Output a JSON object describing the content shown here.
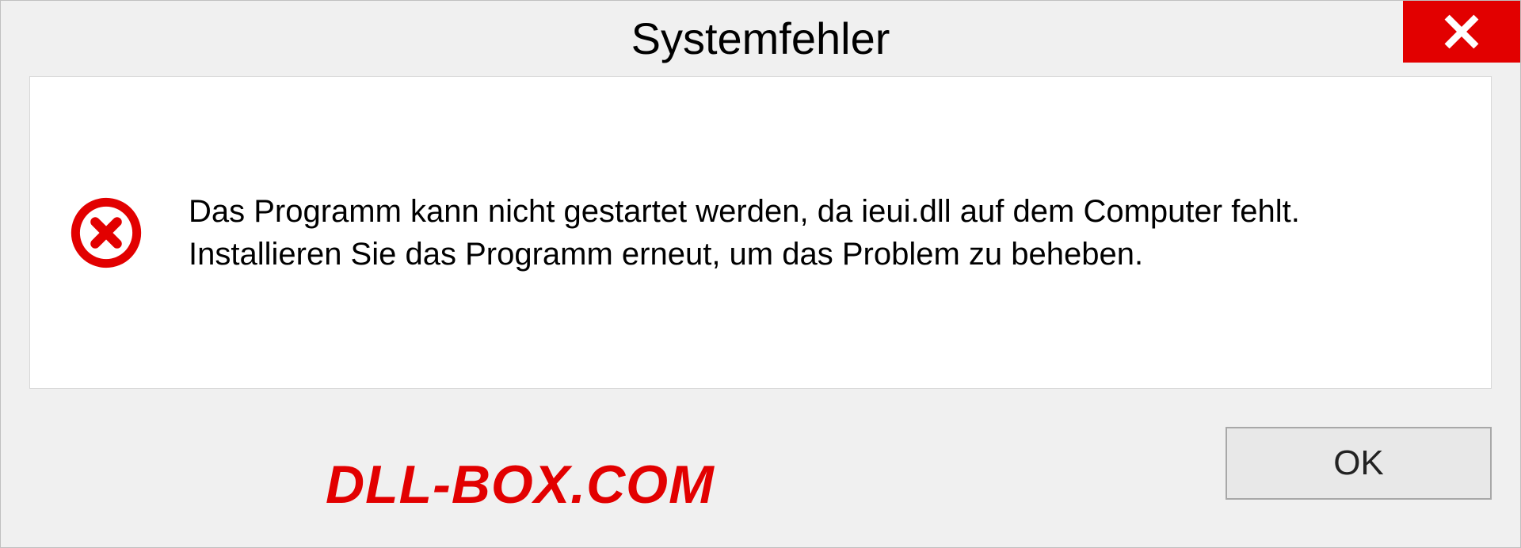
{
  "dialog": {
    "title": "Systemfehler",
    "message": "Das Programm kann nicht gestartet werden, da ieui.dll auf dem Computer fehlt. Installieren Sie das Programm erneut, um das Problem zu beheben.",
    "ok_label": "OK"
  },
  "watermark": "DLL-BOX.COM"
}
